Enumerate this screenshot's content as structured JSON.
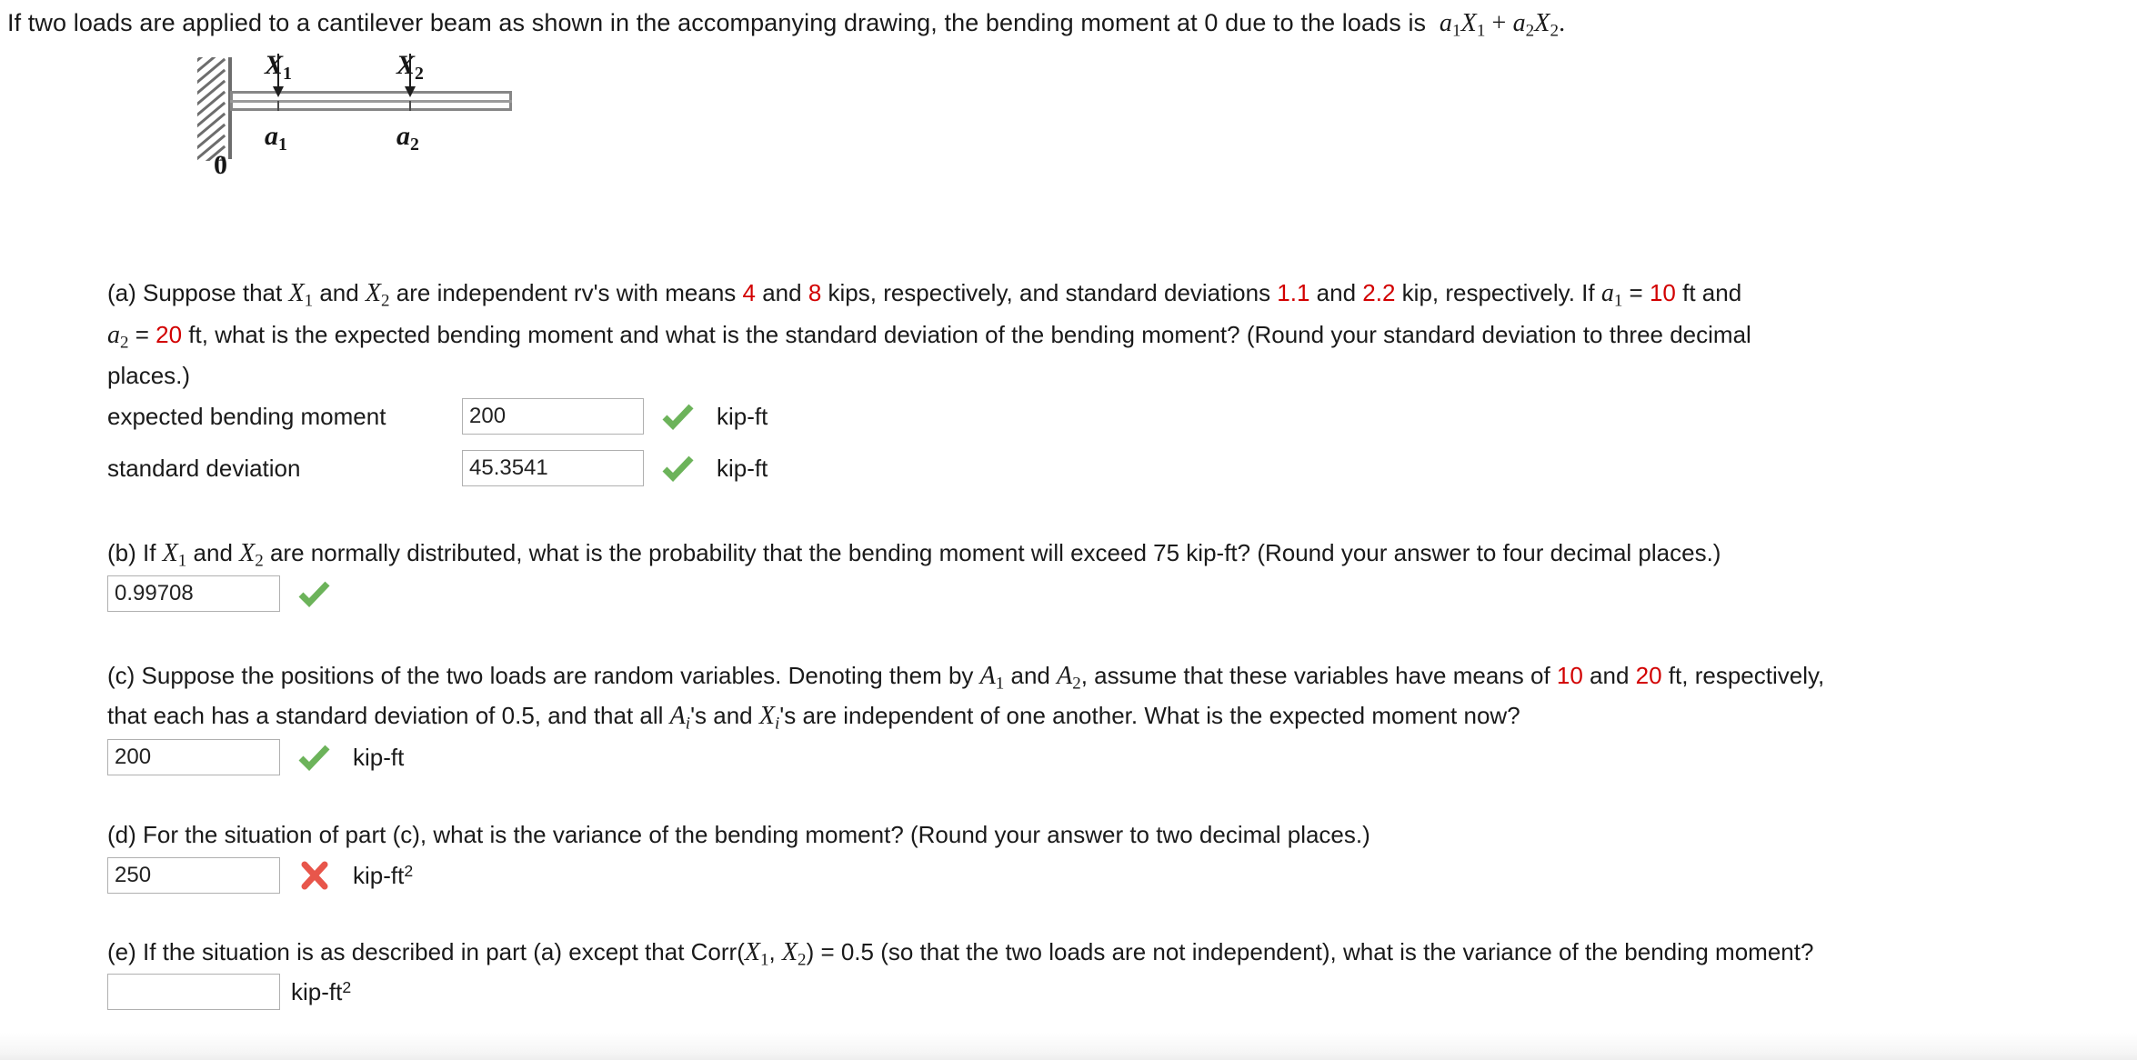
{
  "intro": {
    "before": "If two loads are applied to a cantilever beam as shown in the accompanying drawing, the bending moment at 0 due to the loads is",
    "formula_a1": "a",
    "formula_sub1": "1",
    "formula_X1": "X",
    "formula_Xsub1": "1",
    "plus": "+",
    "formula_a2": "a",
    "formula_sub2": "2",
    "formula_X2": "X",
    "formula_Xsub2": "2",
    "period": "."
  },
  "figure": {
    "load1_label": "X",
    "load1_sub": "1",
    "load2_label": "X",
    "load2_sub": "2",
    "pos1_label": "a",
    "pos1_sub": "1",
    "pos2_label": "a",
    "pos2_sub": "2",
    "origin_label": "0"
  },
  "parts": {
    "a": {
      "line1_pre": "(a) Suppose that ",
      "X1": "X",
      "and1": " and ",
      "X2": "X",
      "line1_mid": " are independent rv's with means ",
      "mean1": "4",
      "and2": " and ",
      "mean2": "8",
      "line1_post": " kips, respectively, and standard deviations ",
      "sd1": "1.1",
      "and3": " and ",
      "sd2": "2.2",
      "line1_end": " kip, respectively. If ",
      "a1": "a",
      "eq1": " = ",
      "a1val": "10",
      "ft1": " ft  and",
      "line2_a2": "a",
      "eq2": " = ",
      "a2val": "20",
      "line2_rest": " ft,  what is the expected bending moment and what is the standard deviation of the bending moment? (Round your standard deviation to three decimal",
      "line3": "places.)",
      "field1_label": "expected bending moment",
      "field1_value": "200",
      "field1_mark": "correct",
      "field1_unit": "kip-ft",
      "field2_label": "standard deviation",
      "field2_value": "45.3541",
      "field2_mark": "correct",
      "field2_unit": "kip-ft"
    },
    "b": {
      "pre": "(b) If ",
      "X1": "X",
      "and": " and ",
      "X2": "X",
      "post": " are normally distributed, what is the probability that the bending moment will exceed 75 kip-ft? (Round your answer to four decimal places.)",
      "value": "0.99708",
      "mark": "correct",
      "unit": ""
    },
    "c": {
      "line1_pre": "(c) Suppose the positions of the two loads are random variables. Denoting them by ",
      "A1": "A",
      "and1": " and ",
      "A2": "A",
      "line1_mid": ", assume that these variables have means of ",
      "mean1": "10",
      "and2": " and ",
      "mean2": "20",
      "line1_end": " ft, respectively,",
      "line2_pre": "that each has a standard deviation of 0.5, and that all  ",
      "Ai": "A",
      "Ai_sub": "i",
      "Ai_post": "'s",
      "line2_mid": "  and  ",
      "Xi": "X",
      "Xi_sub": "i",
      "Xi_post": "'s",
      "line2_end": "  are independent of one another. What is the expected moment now?",
      "value": "200",
      "mark": "correct",
      "unit": "kip-ft"
    },
    "d": {
      "text": "(d) For the situation of part (c), what is the variance of the bending moment? (Round your answer to two decimal places.)",
      "value": "250",
      "mark": "incorrect",
      "unit_base": "kip-ft",
      "unit_sup": "2"
    },
    "e": {
      "pre": "(e) If the situation is as described in part (a) except that  Corr(",
      "X1": "X",
      "comma": ", ",
      "X2": "X",
      "post": ") = 0.5  (so that the two loads are not independent), what is the variance of the bending moment?",
      "value": "",
      "placeholder": "",
      "mark": "none",
      "unit_base": "kip-ft",
      "unit_sup": "2"
    }
  },
  "colors": {
    "highlight_red": "#d20000",
    "correct_green": "#6cb35a",
    "incorrect_red": "#e8564b",
    "input_border": "#b0b0b0"
  }
}
